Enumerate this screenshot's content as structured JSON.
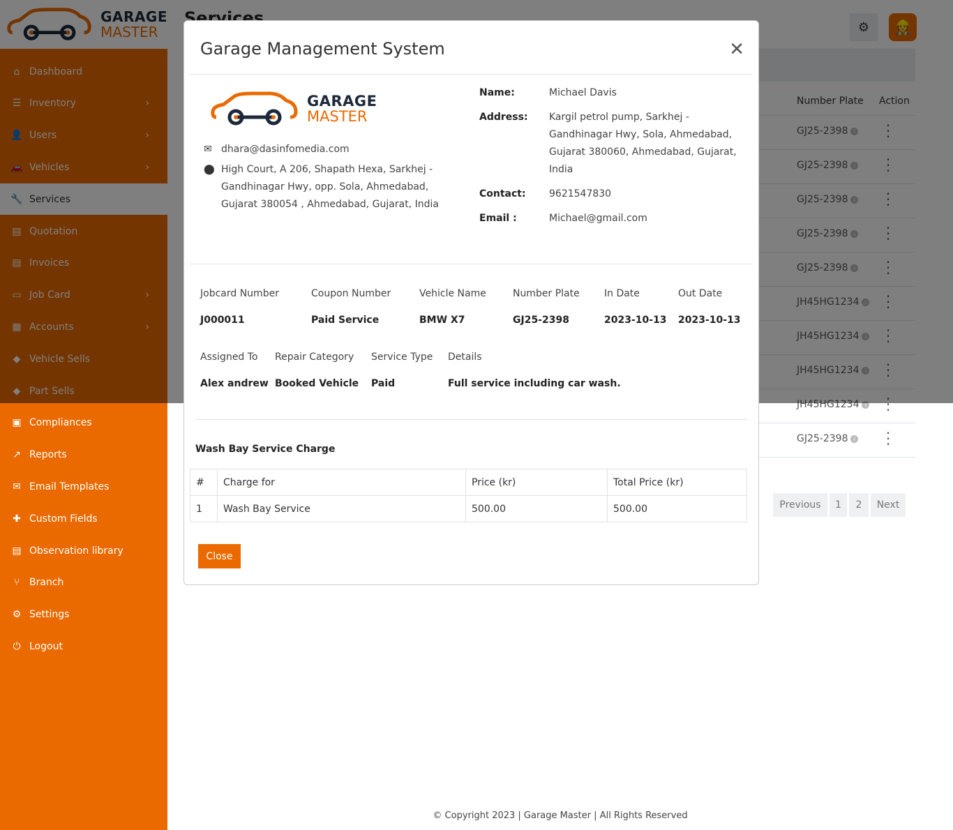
{
  "brand": {
    "line1": "GARAGE",
    "line2": "MASTER"
  },
  "sidebar": {
    "items": [
      {
        "label": "Dashboard",
        "icon": "home-icon",
        "glyph": "⌂",
        "chev": false
      },
      {
        "label": "Inventory",
        "icon": "sliders-icon",
        "glyph": "☰",
        "chev": true
      },
      {
        "label": "Users",
        "icon": "user-icon",
        "glyph": "👤",
        "chev": true
      },
      {
        "label": "Vehicles",
        "icon": "car-icon",
        "glyph": "🚗",
        "chev": true
      },
      {
        "label": "Services",
        "icon": "wrench-icon",
        "glyph": "🔧",
        "chev": false,
        "active": true
      },
      {
        "label": "Quotation",
        "icon": "file-icon",
        "glyph": "▤",
        "chev": false
      },
      {
        "label": "Invoices",
        "icon": "invoice-icon",
        "glyph": "▤",
        "chev": false
      },
      {
        "label": "Job Card",
        "icon": "card-icon",
        "glyph": "▭",
        "chev": true
      },
      {
        "label": "Accounts",
        "icon": "calculator-icon",
        "glyph": "▦",
        "chev": true
      },
      {
        "label": "Vehicle Sells",
        "icon": "tag-icon",
        "glyph": "◆",
        "chev": false
      },
      {
        "label": "Part Sells",
        "icon": "tag-icon",
        "glyph": "◆",
        "chev": false
      },
      {
        "label": "Compliances",
        "icon": "clipboard-icon",
        "glyph": "▣",
        "chev": false
      },
      {
        "label": "Reports",
        "icon": "chart-icon",
        "glyph": "↗",
        "chev": false
      },
      {
        "label": "Email Templates",
        "icon": "email-template-icon",
        "glyph": "✉",
        "chev": false
      },
      {
        "label": "Custom Fields",
        "icon": "puzzle-icon",
        "glyph": "✚",
        "chev": false
      },
      {
        "label": "Observation library",
        "icon": "document-icon",
        "glyph": "▤",
        "chev": false
      },
      {
        "label": "Branch",
        "icon": "branch-icon",
        "glyph": "⑂",
        "chev": false
      },
      {
        "label": "Settings",
        "icon": "gear-icon",
        "glyph": "⚙",
        "chev": false
      },
      {
        "label": "Logout",
        "icon": "power-icon",
        "glyph": "⏻",
        "chev": false
      }
    ]
  },
  "page": {
    "title": "Services",
    "table_headers": [
      "Number Plate",
      "Action"
    ],
    "rows": [
      "GJ25-2398",
      "GJ25-2398",
      "GJ25-2398",
      "GJ25-2398",
      "GJ25-2398",
      "JH45HG1234",
      "JH45HG1234",
      "JH45HG1234",
      "JH45HG1234",
      "GJ25-2398"
    ],
    "pagination": [
      "Previous",
      "1",
      "2",
      "Next"
    ]
  },
  "footer": "© Copyright 2023 | Garage Master | All Rights Reserved",
  "modal": {
    "title": "Garage Management System",
    "company_email": "dhara@dasinfomedia.com",
    "company_address": "High Court, A 206, Shapath Hexa, Sarkhej - Gandhinagar Hwy, opp. Sola, Ahmedabad, Gujarat 380054 , Ahmedabad, Gujarat, India",
    "customer": {
      "name_label": "Name:",
      "name": "Michael Davis",
      "address_label": "Address:",
      "address": "Kargil petrol pump, Sarkhej - Gandhinagar Hwy, Sola, Ahmedabad, Gujarat 380060, Ahmedabad, Gujarat, India",
      "contact_label": "Contact:",
      "contact": "9621547830",
      "email_label": "Email :",
      "email": "Michael@gmail.com"
    },
    "job": {
      "labels1": [
        "Jobcard Number",
        "Coupon Number",
        "Vehicle Name",
        "Number Plate",
        "In Date",
        "Out Date"
      ],
      "values1": [
        "J000011",
        "Paid Service",
        "BMW X7",
        "GJ25-2398",
        "2023-10-13",
        "2023-10-13"
      ],
      "labels2": [
        "Assigned To",
        "Repair Category",
        "Service Type",
        "Details"
      ],
      "values2": [
        "Alex andrew",
        "Booked Vehicle",
        "Paid",
        "Full service including car wash."
      ]
    },
    "charges": {
      "title": "Wash Bay Service Charge",
      "headers": [
        "#",
        "Charge for",
        "Price (kr)",
        "Total Price (kr)"
      ],
      "rows": [
        [
          "1",
          "Wash Bay Service",
          "500.00",
          "500.00"
        ]
      ]
    },
    "close_label": "Close"
  },
  "colors": {
    "accent": "#ea6a00",
    "navy": "#1d2838"
  }
}
